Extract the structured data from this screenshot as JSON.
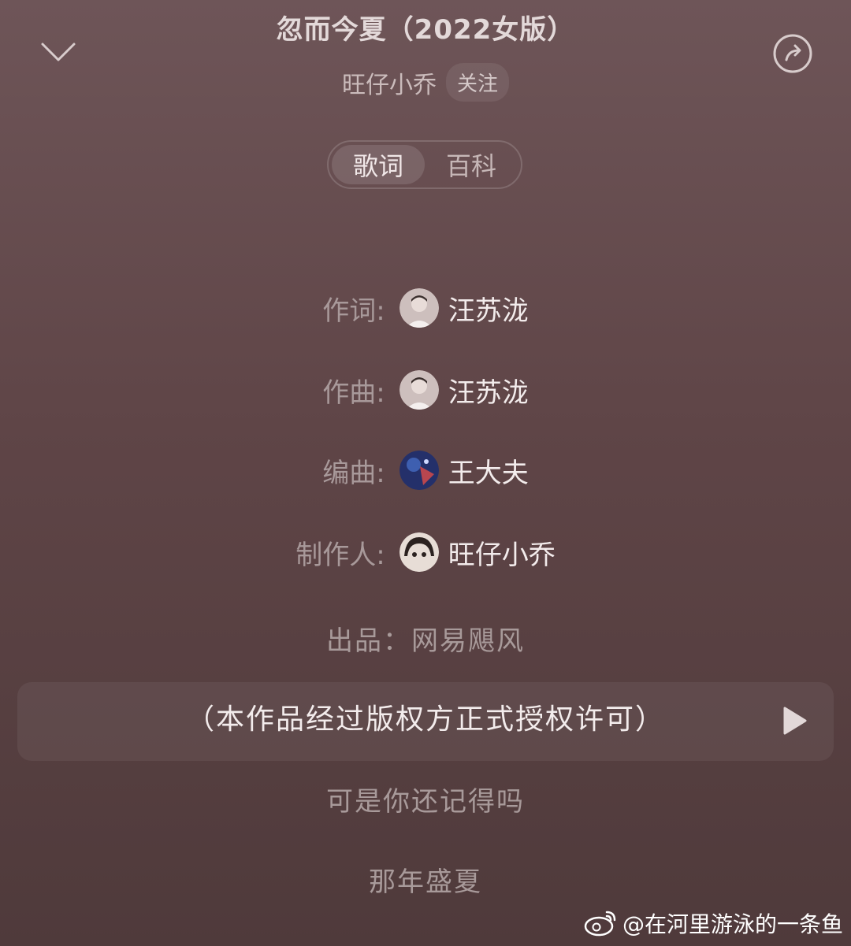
{
  "header": {
    "title": "忽而今夏（2022女版）",
    "artist": "旺仔小乔",
    "follow_label": "关注"
  },
  "tabs": [
    {
      "label": "歌词",
      "active": true
    },
    {
      "label": "百科",
      "active": false
    }
  ],
  "credits": [
    {
      "label": "作词:",
      "name": "汪苏泷",
      "avatar": "person-avatar"
    },
    {
      "label": "作曲:",
      "name": "汪苏泷",
      "avatar": "person-avatar"
    },
    {
      "label": "编曲:",
      "name": "王大夫",
      "avatar": "blue-avatar"
    },
    {
      "label": "制作人:",
      "name": "旺仔小乔",
      "avatar": "anime-avatar"
    }
  ],
  "producer": "出品：网易飓风",
  "current_line": "（本作品经过版权方正式授权许可）",
  "lyrics": [
    "可是你还记得吗",
    "那年盛夏"
  ],
  "watermark": "@在河里游泳的一条鱼",
  "colors": {
    "background": "#5f4547",
    "highlight": "#f3ecec",
    "dim": "#a89a9a"
  }
}
